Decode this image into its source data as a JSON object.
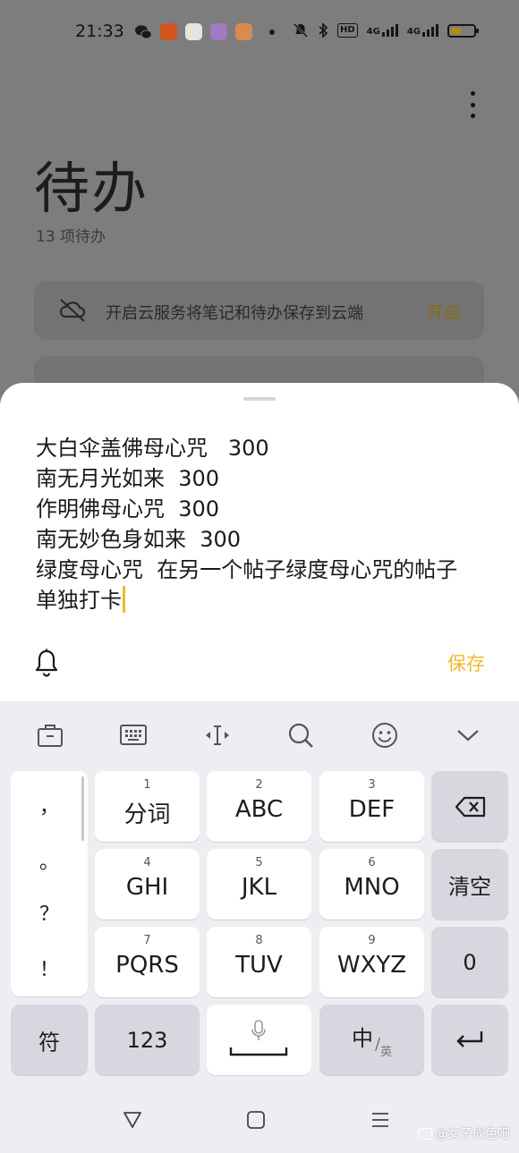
{
  "status_bar": {
    "time": "21:33",
    "hd_label": "HD",
    "net1": "4G",
    "net2": "4G",
    "battery_level": 0.45
  },
  "app": {
    "title": "待办",
    "count": "13 项待办",
    "cloud_banner": {
      "text": "开启云服务将笔记和待办保存到云端",
      "action": "开启"
    }
  },
  "sheet": {
    "lines": [
      "大白伞盖佛母心咒   300",
      "南无月光如来  300",
      "作明佛母心咒  300",
      "南无妙色身如来  300",
      "绿度母心咒  在另一个帖子绿度母心咒的帖子",
      "单独打卡"
    ],
    "save_label": "保存"
  },
  "keyboard": {
    "punct": [
      "，",
      "。",
      "？",
      "！"
    ],
    "keys": [
      {
        "num": "1",
        "label": "分词"
      },
      {
        "num": "2",
        "label": "ABC"
      },
      {
        "num": "3",
        "label": "DEF"
      },
      {
        "num": "4",
        "label": "GHI"
      },
      {
        "num": "5",
        "label": "JKL"
      },
      {
        "num": "6",
        "label": "MNO"
      },
      {
        "num": "7",
        "label": "PQRS"
      },
      {
        "num": "8",
        "label": "TUV"
      },
      {
        "num": "9",
        "label": "WXYZ"
      }
    ],
    "clear_label": "清空",
    "zero_label": "0",
    "symbol_label": "符",
    "num_label": "123",
    "lang_main": "中",
    "lang_sub": "英"
  },
  "watermark": "@女子成色吧",
  "colors": {
    "accent": "#f0b92c"
  }
}
